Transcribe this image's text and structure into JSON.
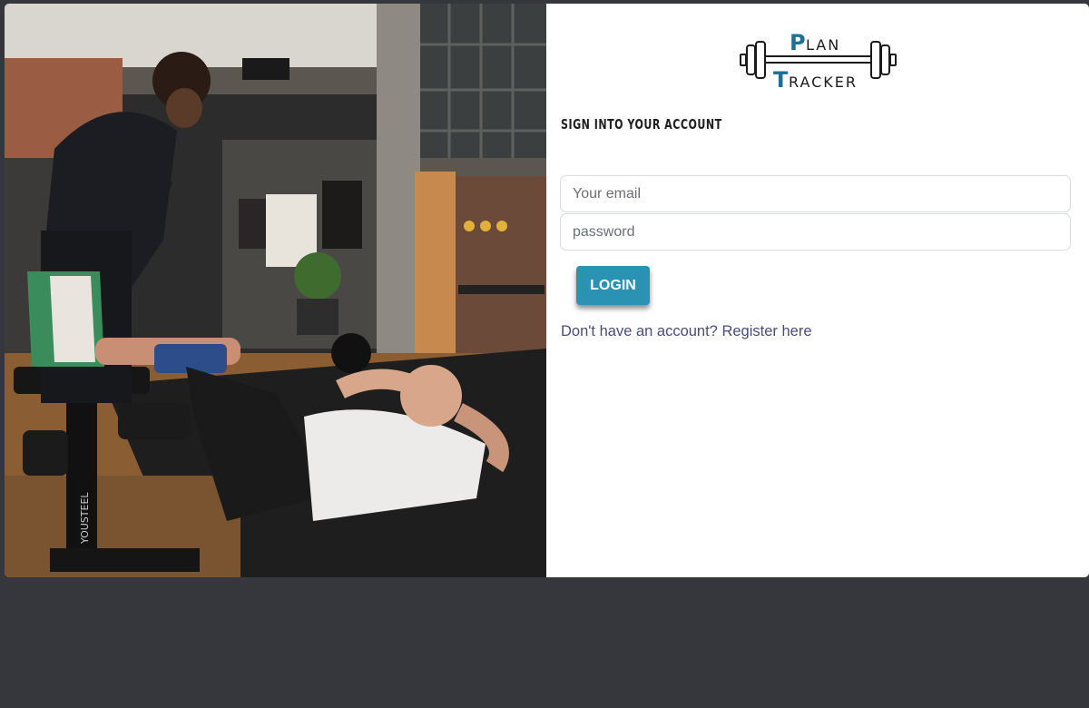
{
  "logo": {
    "line1_initial": "P",
    "line1_rest": "LAN",
    "line2_initial": "T",
    "line2_rest": "RACKER",
    "icon": "barbell-icon"
  },
  "photo": {
    "subject": "gym-workout-photo"
  },
  "form": {
    "title": "SIGN INTO YOUR ACCOUNT",
    "email_placeholder": "Your email",
    "password_placeholder": "password",
    "login_label": "LOGIN",
    "register_prompt": "Don't have an account?",
    "register_link": "Register here"
  },
  "colors": {
    "page_background": "#35373c",
    "accent": "#2a93b3",
    "link": "#4a4d7a"
  }
}
